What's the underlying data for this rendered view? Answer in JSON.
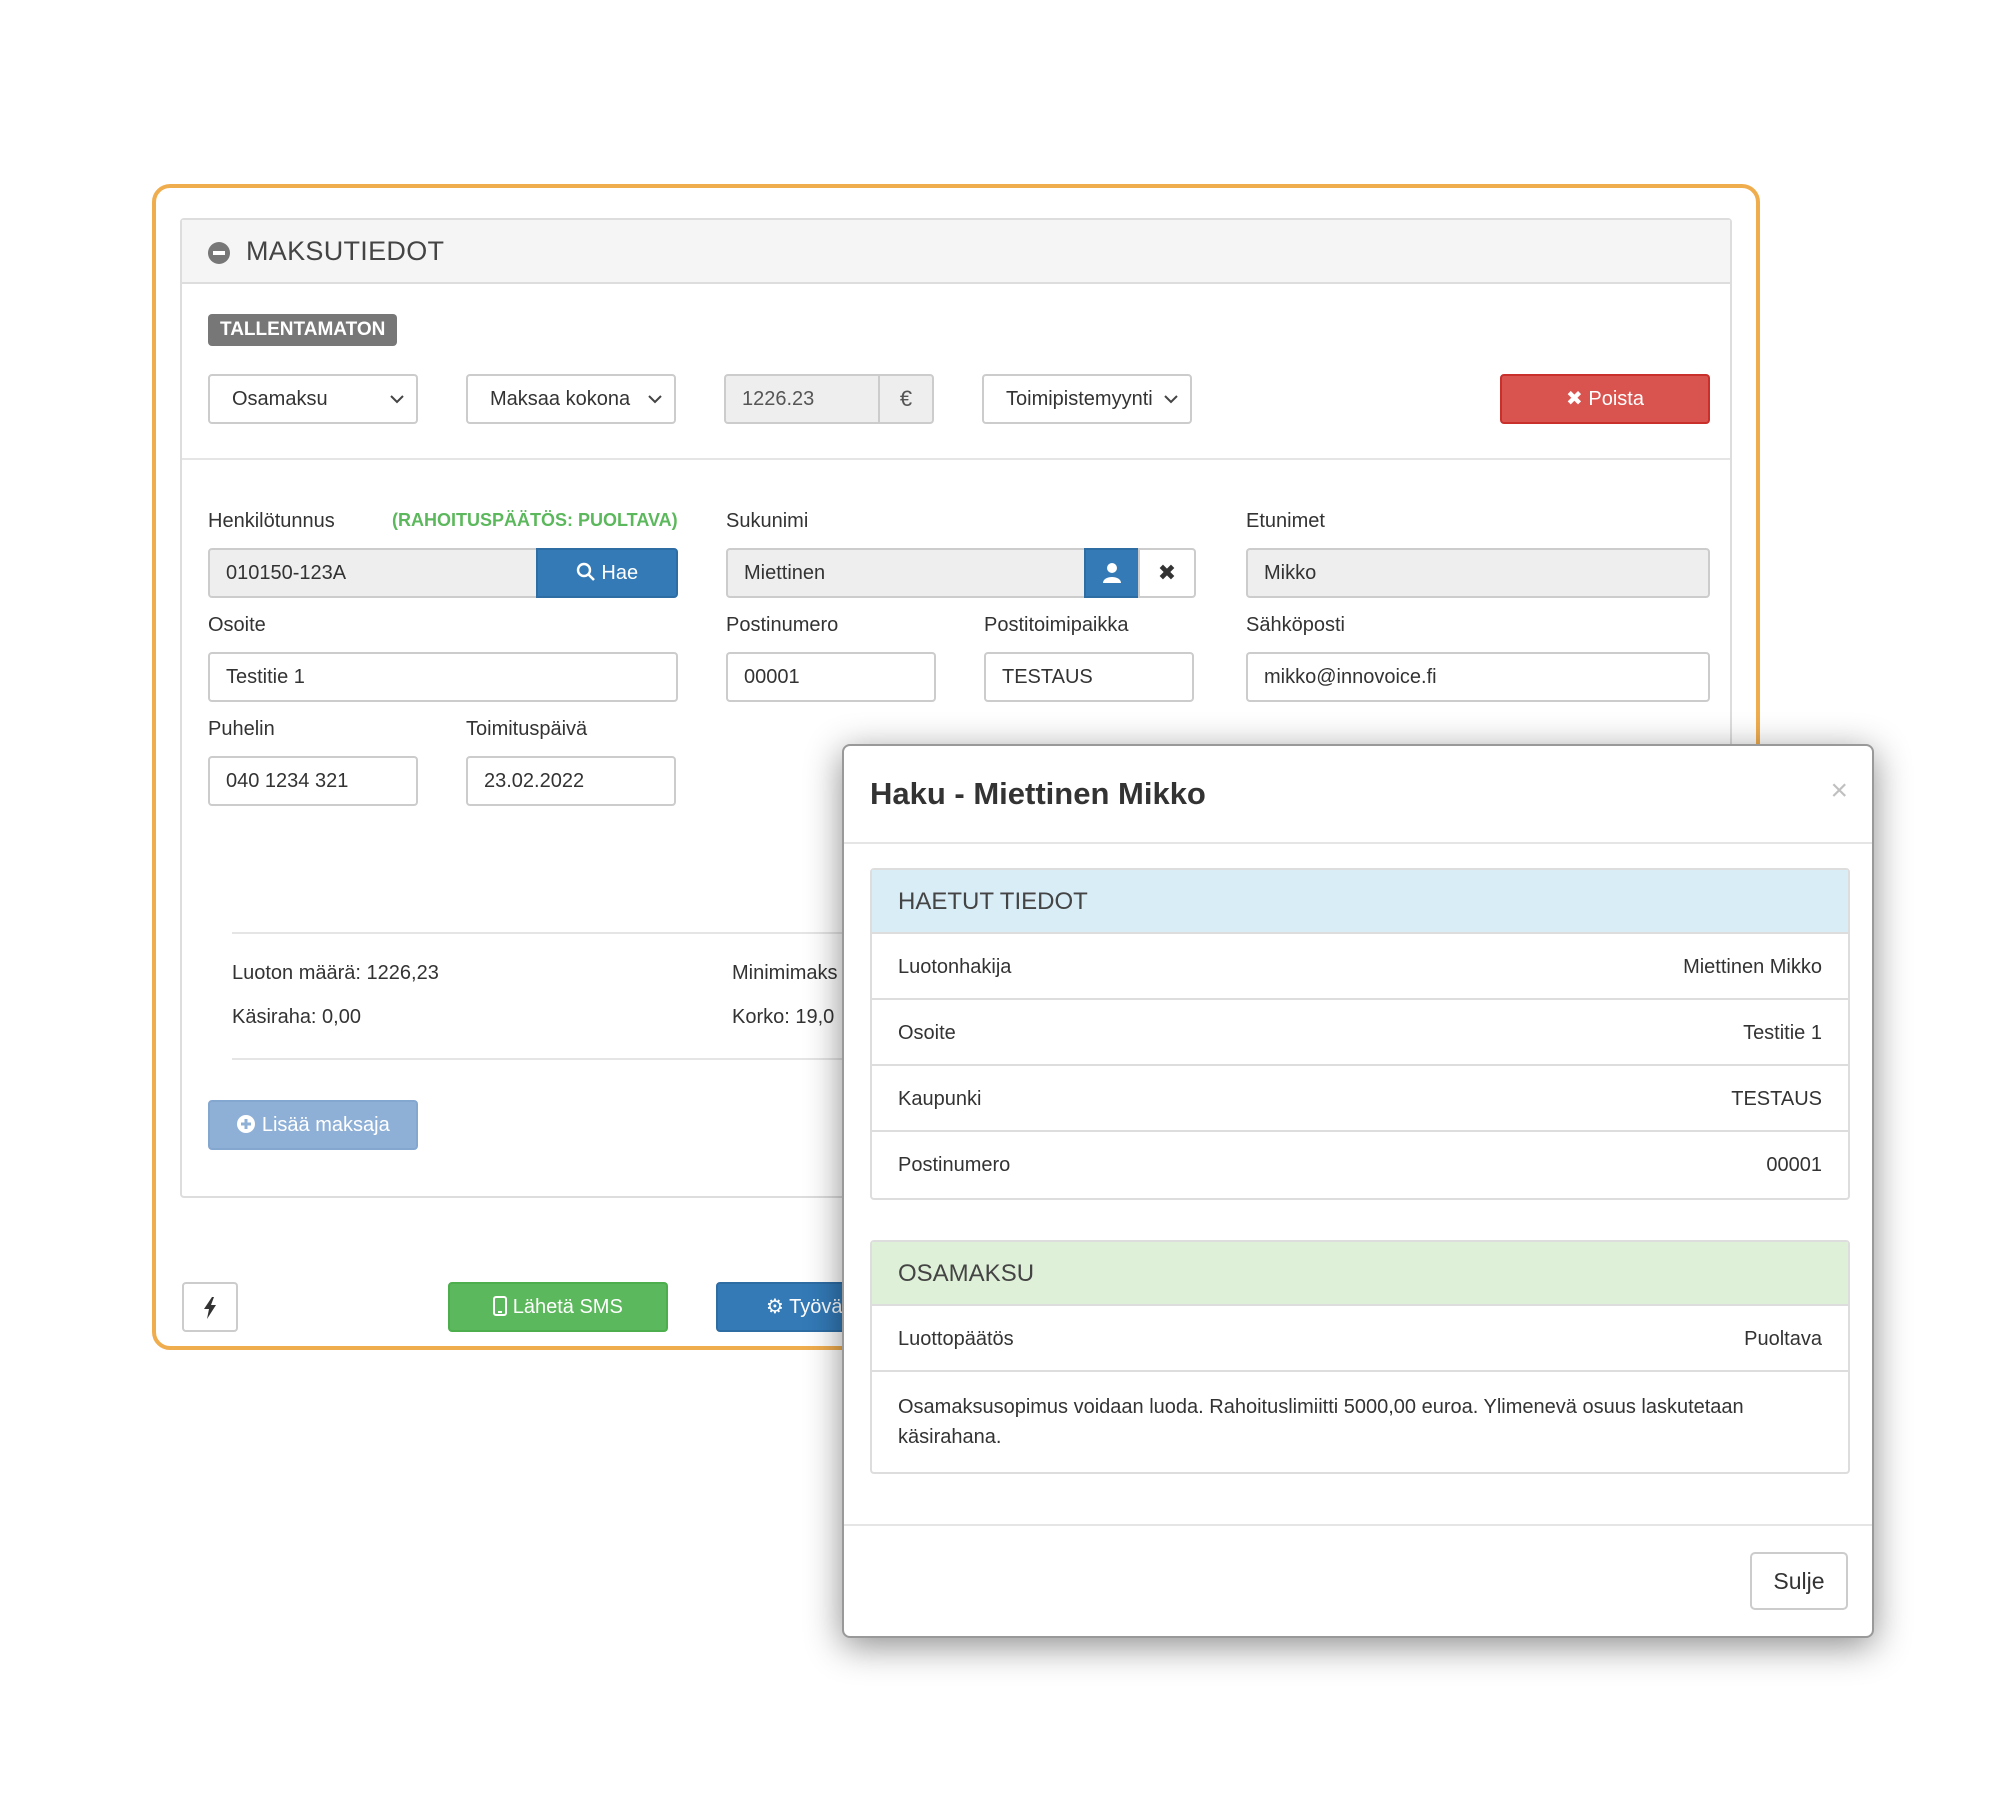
{
  "panel": {
    "title": "MAKSUTIEDOT",
    "status_badge": "TALLENTAMATON"
  },
  "toolbar": {
    "payment_type": "Osamaksu",
    "payment_mode": "Maksaa kokona",
    "amount": "1226.23",
    "currency": "€",
    "sales_channel": "Toimipistemyynti",
    "delete_label": "Poista"
  },
  "form": {
    "ssn_label": "Henkilötunnus",
    "decision_note": "(RAHOITUSPÄÄTÖS: PUOLTAVA)",
    "ssn_value": "010150-123A",
    "search_label": "Hae",
    "lastname_label": "Sukunimi",
    "lastname_value": "Miettinen",
    "firstnames_label": "Etunimet",
    "firstnames_value": "Mikko",
    "address_label": "Osoite",
    "address_value": "Testitie 1",
    "postcode_label": "Postinumero",
    "postcode_value": "00001",
    "city_label": "Postitoimipaikka",
    "city_value": "TESTAUS",
    "email_label": "Sähköposti",
    "email_value": "mikko@innovoice.fi",
    "phone_label": "Puhelin",
    "phone_value": "040 1234 321",
    "delivery_label": "Toimituspäivä",
    "delivery_value": "23.02.2022"
  },
  "summary": {
    "loan_amount": "Luoton määrä: 1226,23",
    "down_payment": "Käsiraha: 0,00",
    "min_payment": "Minimimaks",
    "interest": "Korko: 19,0"
  },
  "actions": {
    "add_payer": "Lisää maksaja",
    "send_sms": "Lähetä SMS",
    "work": "Työvä"
  },
  "modal": {
    "title": "Haku - Miettinen Mikko",
    "fetched_heading": "HAETUT TIEDOT",
    "fetched_rows": [
      {
        "label": "Luotonhakija",
        "value": "Miettinen Mikko"
      },
      {
        "label": "Osoite",
        "value": "Testitie 1"
      },
      {
        "label": "Kaupunki",
        "value": "TESTAUS"
      },
      {
        "label": "Postinumero",
        "value": "00001"
      }
    ],
    "installment_heading": "OSAMAKSU",
    "decision_label": "Luottopäätös",
    "decision_value": "Puoltava",
    "message": "Osamaksusopimus voidaan luoda. Rahoituslimiitti 5000,00 euroa. Ylimenevä osuus laskutetaan käsirahana.",
    "close_label": "Sulje"
  },
  "colors": {
    "frame": "#f0ad4e",
    "primary": "#337ab7",
    "danger": "#d9534f",
    "success": "#5cb85c",
    "decision_note": "#5cb85c"
  },
  "icons": [
    "minus-circle-icon",
    "chevron-down-icon",
    "times-icon",
    "search-icon",
    "user-icon",
    "plus-circle-icon",
    "bolt-icon",
    "mobile-phone-icon",
    "gear-icon",
    "close-icon"
  ]
}
